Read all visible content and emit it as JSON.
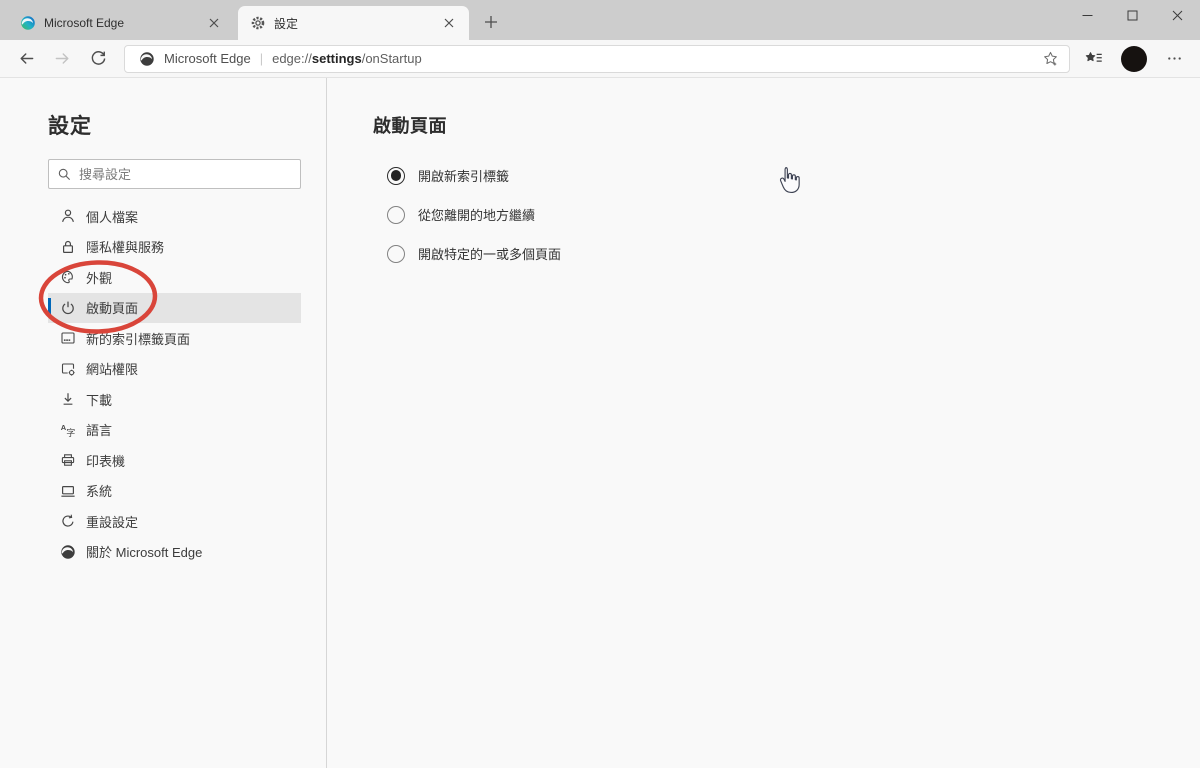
{
  "tabs": [
    {
      "title": "Microsoft Edge",
      "icon": "edge-logo-color-icon",
      "active": false
    },
    {
      "title": "設定",
      "icon": "gear-icon",
      "active": true
    }
  ],
  "toolbar": {
    "site_label": "Microsoft Edge",
    "divider": "|",
    "url": {
      "scheme": "edge://",
      "highlight": "settings",
      "rest": "/onStartup"
    },
    "icons": [
      "back-arrow-icon",
      "forward-arrow-icon",
      "refresh-icon",
      "edge-logo-icon",
      "add-favorite-star-icon",
      "favorites-bar-icon",
      "profile-avatar",
      "more-menu-icon"
    ]
  },
  "window_controls": [
    "minimize",
    "maximize",
    "close"
  ],
  "sidebar": {
    "title": "設定",
    "search_placeholder": "搜尋設定",
    "items": [
      {
        "id": "profile",
        "label": "個人檔案",
        "icon": "person-icon",
        "selected": false
      },
      {
        "id": "privacy",
        "label": "隱私權與服務",
        "icon": "lock-icon",
        "selected": false
      },
      {
        "id": "appearance",
        "label": "外觀",
        "icon": "palette-icon",
        "selected": false
      },
      {
        "id": "onstartup",
        "label": "啟動頁面",
        "icon": "power-icon",
        "selected": true
      },
      {
        "id": "newtab",
        "label": "新的索引標籤頁面",
        "icon": "new-tab-page-icon",
        "selected": false
      },
      {
        "id": "permissions",
        "label": "網站權限",
        "icon": "site-permissions-icon",
        "selected": false
      },
      {
        "id": "downloads",
        "label": "下載",
        "icon": "download-icon",
        "selected": false
      },
      {
        "id": "languages",
        "label": "語言",
        "icon": "language-icon",
        "selected": false
      },
      {
        "id": "printers",
        "label": "印表機",
        "icon": "printer-icon",
        "selected": false
      },
      {
        "id": "system",
        "label": "系統",
        "icon": "laptop-icon",
        "selected": false
      },
      {
        "id": "reset",
        "label": "重設設定",
        "icon": "reset-icon",
        "selected": false
      },
      {
        "id": "about",
        "label": "關於 Microsoft Edge",
        "icon": "edge-logo-dark-icon",
        "selected": false
      }
    ]
  },
  "main": {
    "heading": "啟動頁面",
    "options": [
      {
        "label": "開啟新索引標籤",
        "selected": true
      },
      {
        "label": "從您離開的地方繼續",
        "selected": false
      },
      {
        "label": "開啟特定的一或多個頁面",
        "selected": false
      }
    ]
  },
  "annotation": {
    "shape": "hand-drawn-red-ellipse",
    "target": "啟動頁面",
    "color": "#d9453a"
  },
  "cursor": {
    "type": "hand-pointer"
  },
  "colors": {
    "accent_blue": "#0067b8",
    "annotation_red": "#d9453a",
    "selected_item_bg": "#e4e4e4",
    "tab_bar_bg": "#cdcdcd",
    "chrome_bg": "#f7f7f7",
    "page_bg": "#f9f9f9"
  }
}
